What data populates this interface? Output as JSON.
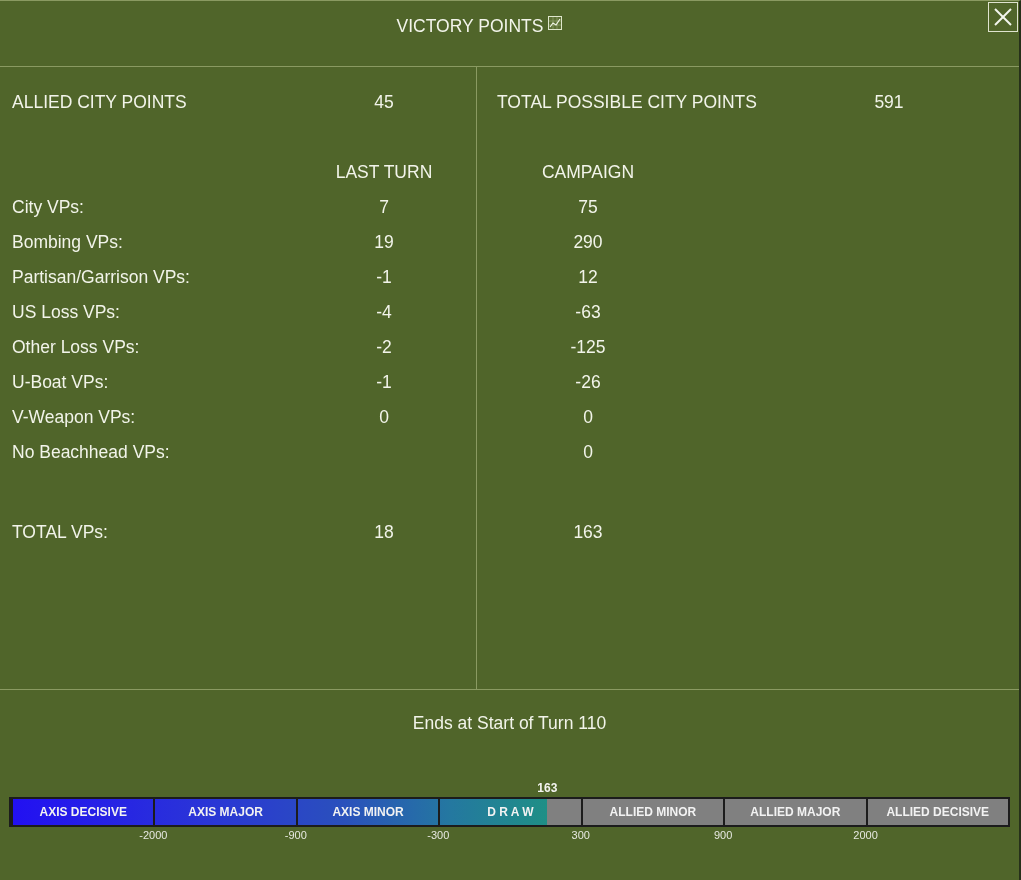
{
  "window": {
    "title": "VICTORY POINTS"
  },
  "city_points": {
    "allied": {
      "label": "ALLIED CITY POINTS",
      "value": "45"
    },
    "total_possible": {
      "label": "TOTAL POSSIBLE CITY POINTS",
      "value": "591"
    }
  },
  "vp_table": {
    "columns": [
      "LAST TURN",
      "CAMPAIGN"
    ],
    "rows": [
      {
        "label": "City VPs:",
        "last_turn": "7",
        "campaign": "75"
      },
      {
        "label": "Bombing VPs:",
        "last_turn": "19",
        "campaign": "290"
      },
      {
        "label": "Partisan/Garrison VPs:",
        "last_turn": "-1",
        "campaign": "12"
      },
      {
        "label": "US Loss VPs:",
        "last_turn": "-4",
        "campaign": "-63"
      },
      {
        "label": "Other Loss VPs:",
        "last_turn": "-2",
        "campaign": "-125"
      },
      {
        "label": "U-Boat VPs:",
        "last_turn": "-1",
        "campaign": "-26"
      },
      {
        "label": "V-Weapon VPs:",
        "last_turn": "0",
        "campaign": "0"
      },
      {
        "label": "No Beachhead VPs:",
        "campaign": "0"
      }
    ],
    "total": {
      "label": "TOTAL VPs:",
      "last_turn": "18",
      "campaign": "163"
    }
  },
  "end_condition": "Ends at Start of Turn 110",
  "victory_bar": {
    "marker": "163",
    "level": 0.538,
    "segments": [
      "AXIS DECISIVE",
      "AXIS MAJOR",
      "AXIS MINOR",
      "D R A W",
      "ALLIED MINOR",
      "ALLIED MAJOR",
      "ALLIED DECISIVE"
    ],
    "ticks": [
      "-2000",
      "-900",
      "-300",
      "300",
      "900",
      "2000"
    ]
  }
}
